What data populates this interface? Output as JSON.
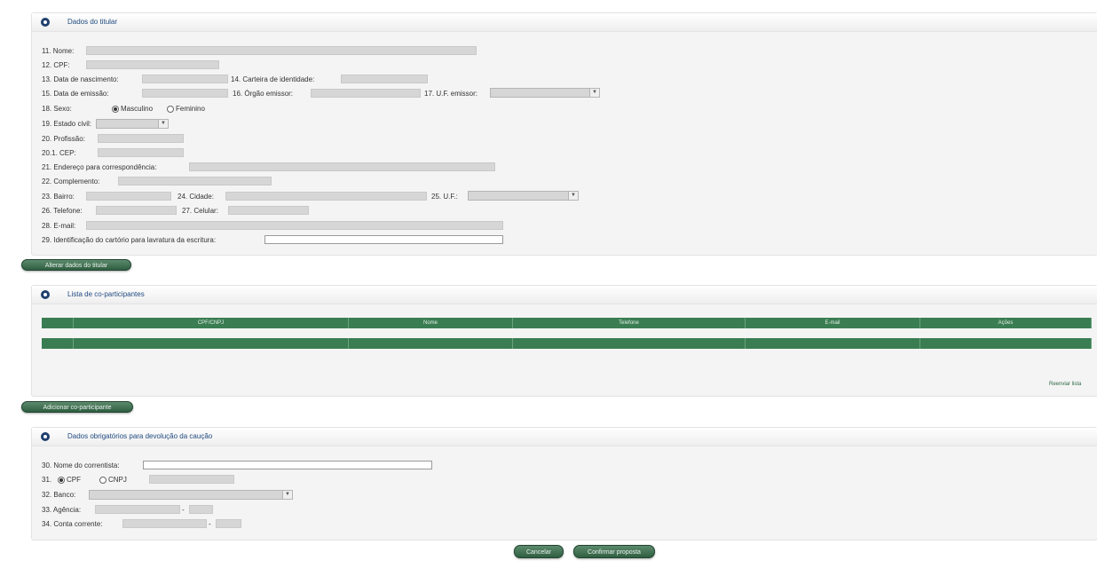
{
  "titular": {
    "title": "Dados do titular",
    "f11": "11. Nome:",
    "f12": "12. CPF:",
    "f13": "13. Data de nascimento:",
    "f14": "14. Carteira de identidade:",
    "f15": "15. Data de emissão:",
    "f16": "16. Órgão emissor:",
    "f17": "17. U.F. emissor:",
    "f18": "18. Sexo:",
    "sexo_m": "Masculino",
    "sexo_f": "Feminino",
    "f19": "19. Estado civil:",
    "f20": "20. Profissão:",
    "f201": "20.1. CEP:",
    "f21": "21. Endereço para correspondência:",
    "f22": "22. Complemento:",
    "f23": "23. Bairro:",
    "f24": "24. Cidade:",
    "f25": "25. U.F.:",
    "f26": "26. Telefone:",
    "f27": "27. Celular:",
    "f28": "28. E-mail:",
    "f29": "29. Identificação do cartório para lavratura da escritura:",
    "button": "Alterar dados do titular"
  },
  "coparticipantes": {
    "title": "Lista de co-participantes",
    "columns": [
      "CPF/CNPJ",
      "Nome",
      "Telefone",
      "E-mail",
      "Ações"
    ],
    "footer": "Reenviar lista",
    "button": "Adicionar co-participante"
  },
  "caucao": {
    "title": "Dados obrigatórios para devolução da caução",
    "f30": "30. Nome do correntista:",
    "f31": "31.",
    "cpf": "CPF",
    "cnpj": "CNPJ",
    "f32": "32. Banco:",
    "f33": "33. Agência:",
    "f34": "34. Conta corrente:"
  },
  "actions": {
    "cancel": "Cancelar",
    "confirm": "Confirmar proposta"
  }
}
